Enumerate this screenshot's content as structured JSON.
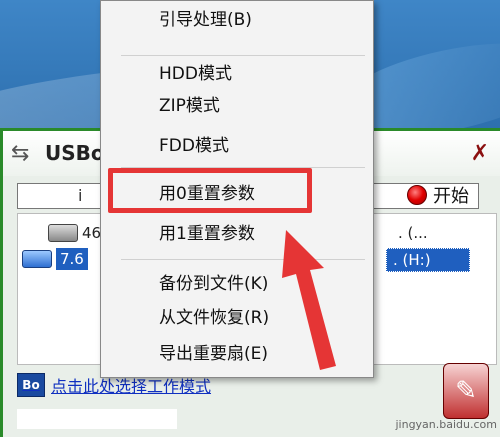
{
  "window": {
    "title": "USBoo",
    "mode_field": "i",
    "start_label": "开始"
  },
  "devices": [
    {
      "label": "465",
      "right": ".  (..."
    },
    {
      "label": "7.6",
      "right": ". (H:)"
    }
  ],
  "bottom_link": "点击此处选择工作模式",
  "context_menu": {
    "items": [
      {
        "label": "引导处理(B)"
      },
      {
        "label": "HDD模式"
      },
      {
        "label": "ZIP模式"
      },
      {
        "label": "FDD模式"
      },
      {
        "label": "用0重置参数"
      },
      {
        "label": "用1重置参数"
      },
      {
        "label": "备份到文件(K)"
      },
      {
        "label": "从文件恢复(R)"
      },
      {
        "label": "导出重要扇(E)"
      }
    ]
  },
  "watermark": "jingyan.baidu.com",
  "colors": {
    "highlight": "#e53535",
    "selection": "#1f5fbf",
    "link": "#1030c0"
  },
  "icons": [
    "usb-icon",
    "close-icon",
    "red-dot-icon",
    "hdd-icon",
    "usb-drive-icon",
    "bo-logo-icon",
    "paint-tool-icon",
    "arrow-annotation-icon"
  ]
}
